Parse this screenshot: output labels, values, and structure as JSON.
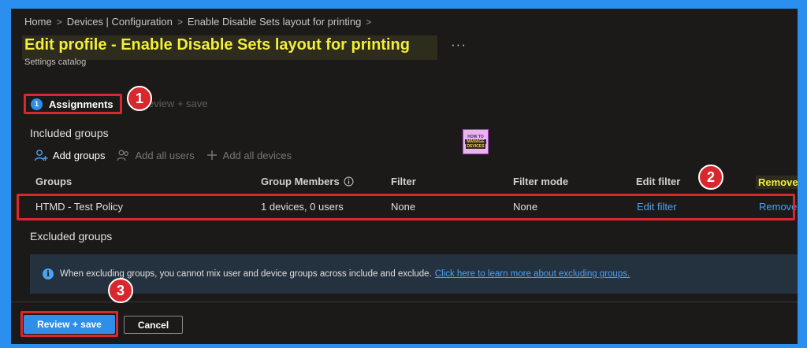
{
  "breadcrumb": {
    "items": [
      "Home",
      "Devices | Configuration",
      "Enable Disable Sets layout for printing"
    ],
    "separator": ">"
  },
  "header": {
    "title": "Edit profile - Enable Disable Sets layout for printing",
    "more_label": "···",
    "subtitle": "Settings catalog"
  },
  "steps": {
    "current_number": "1",
    "current_label": "Assignments",
    "next_label": "eview + save"
  },
  "badges": [
    "1",
    "2",
    "3"
  ],
  "included": {
    "heading": "Included groups",
    "actions": {
      "add_groups": "Add groups",
      "add_all_users": "Add all users",
      "add_all_devices": "Add all devices"
    }
  },
  "logo": {
    "line1": "HOW TO",
    "line2": "MANAGE",
    "line3": "DEVICES"
  },
  "table": {
    "columns": {
      "groups": "Groups",
      "group_members": "Group Members",
      "filter": "Filter",
      "filter_mode": "Filter mode",
      "edit_filter": "Edit filter",
      "remove": "Remove"
    },
    "rows": [
      {
        "group": "HTMD - Test Policy",
        "members": "1 devices, 0 users",
        "filter": "None",
        "filter_mode": "None",
        "edit_filter": "Edit filter",
        "remove": "Remove"
      }
    ]
  },
  "excluded": {
    "heading": "Excluded groups",
    "info_text": "When excluding groups, you cannot mix user and device groups across include and exclude.",
    "info_link": "Click here to learn more about excluding groups."
  },
  "footer": {
    "primary": "Review + save",
    "secondary": "Cancel"
  },
  "colors": {
    "outer_frame": "#2b8ff0",
    "background": "#1b1a19",
    "title_highlight": "#f2ee3a",
    "annotation_red": "#d9272e",
    "link_blue": "#4aa3f2",
    "primary_button": "#2f8fe8"
  }
}
